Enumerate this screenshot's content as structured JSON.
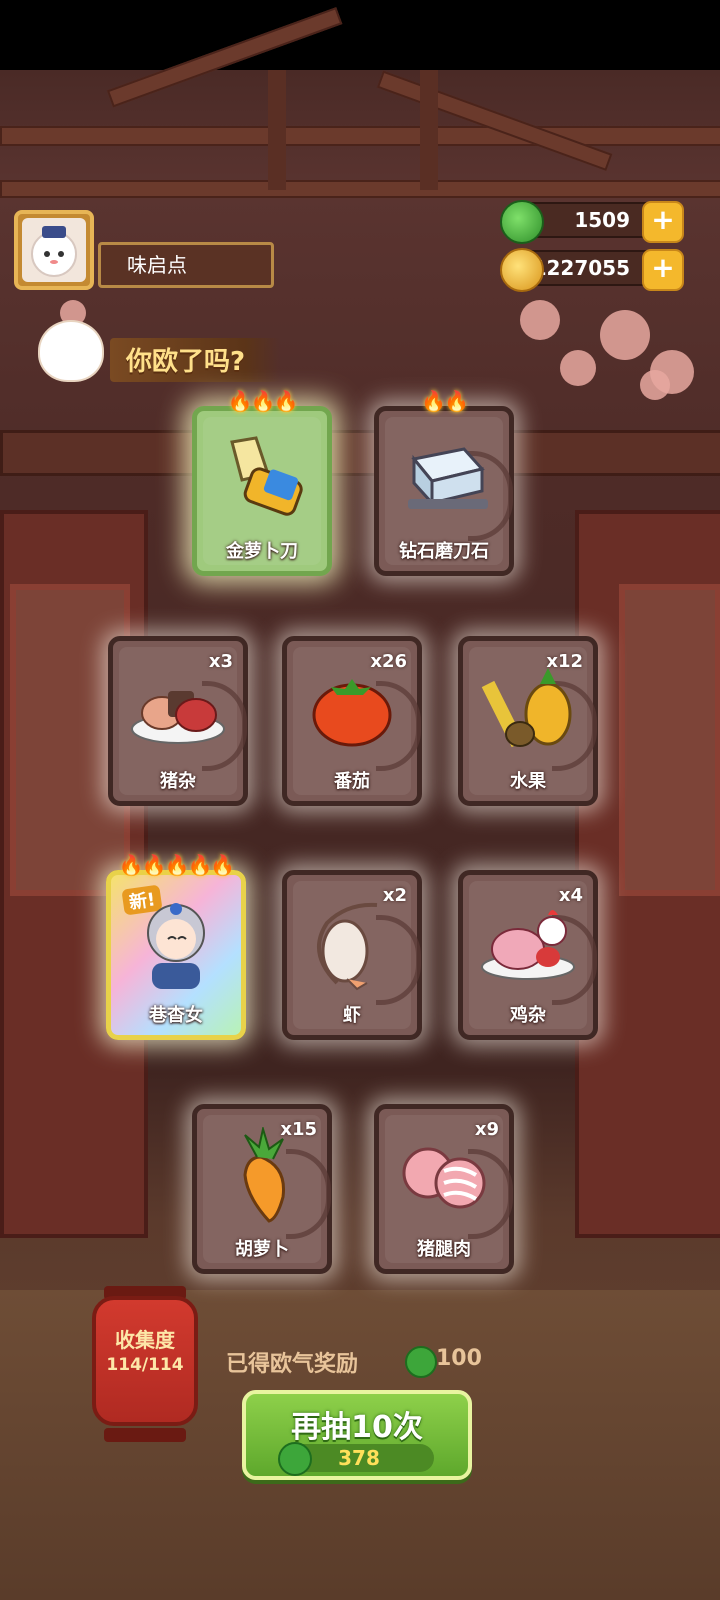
{
  "player": {
    "name": "味启点"
  },
  "currencies": {
    "gems": {
      "value": "1509",
      "icon": "green-gem-icon",
      "color": "#3da63a"
    },
    "coins": {
      "value": "51227055",
      "icon": "gold-coin-icon",
      "color": "#f0b52a"
    }
  },
  "banner": {
    "text": "你欧了吗?"
  },
  "cards": [
    {
      "label": "金萝卜刀",
      "count": "",
      "flames": "🔥🔥🔥",
      "style": "green",
      "icon": "golden-carrot-knife-icon"
    },
    {
      "label": "钻石磨刀石",
      "count": "",
      "flames": "🔥🔥",
      "style": "normal",
      "icon": "diamond-whetstone-icon"
    },
    {
      "label": "猪杂",
      "count": "x3",
      "style": "normal",
      "icon": "pig-offal-icon"
    },
    {
      "label": "番茄",
      "count": "x26",
      "style": "normal",
      "icon": "tomato-icon"
    },
    {
      "label": "水果",
      "count": "x12",
      "style": "normal",
      "icon": "fruit-icon"
    },
    {
      "label": "巷杳女",
      "count": "",
      "flames": "🔥🔥🔥🔥🔥",
      "style": "rainbow",
      "new_tag": "新!",
      "icon": "character-portrait-icon"
    },
    {
      "label": "虾",
      "count": "x2",
      "style": "normal",
      "icon": "shrimp-icon"
    },
    {
      "label": "鸡杂",
      "count": "x4",
      "style": "normal",
      "icon": "chicken-offal-icon"
    },
    {
      "label": "胡萝卜",
      "count": "x15",
      "style": "normal",
      "icon": "carrot-icon"
    },
    {
      "label": "猪腿肉",
      "count": "x9",
      "style": "normal",
      "icon": "pork-leg-icon"
    }
  ],
  "collection": {
    "title": "收集度",
    "value": "114/114"
  },
  "reward": {
    "label": "已得欧气奖励",
    "value": "100"
  },
  "draw_again": {
    "label": "再抽10次",
    "cost": "378"
  }
}
